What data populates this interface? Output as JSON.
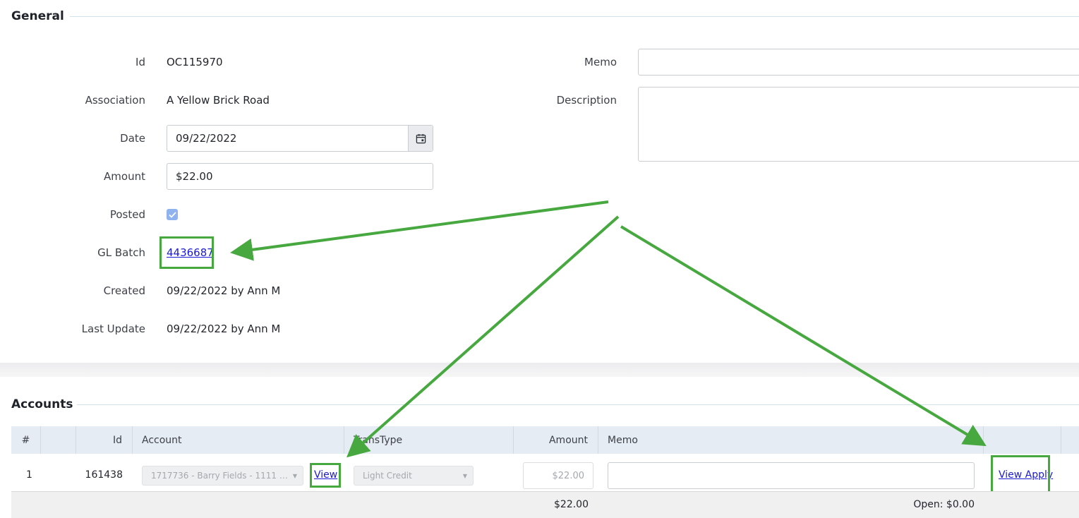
{
  "general": {
    "title": "General",
    "labels": {
      "id": "Id",
      "association": "Association",
      "date": "Date",
      "amount": "Amount",
      "posted": "Posted",
      "gl_batch": "GL Batch",
      "created": "Created",
      "last_update": "Last Update",
      "memo": "Memo",
      "description": "Description"
    },
    "values": {
      "id": "OC115970",
      "association": "A Yellow Brick Road",
      "date": "09/22/2022",
      "amount": "$22.00",
      "posted": true,
      "gl_batch": "4436687",
      "created": "09/22/2022 by Ann M",
      "last_update": "09/22/2022 by Ann M",
      "memo": "",
      "description": ""
    }
  },
  "accounts": {
    "title": "Accounts",
    "columns": [
      "#",
      "Id",
      "Account",
      "TransType",
      "Amount",
      "Memo"
    ],
    "rows": [
      {
        "num": "1",
        "id": "161438",
        "account": "1717736 - Barry Fields - 1111 Newto...",
        "view_label": "View",
        "trans_type": "Light Credit",
        "amount": "$22.00",
        "memo": "",
        "view_apply_label": "View Apply"
      }
    ],
    "footer": {
      "amount_total": "$22.00",
      "open": "Open: $0.00"
    }
  },
  "icons": {
    "calendar": "calendar-icon",
    "check": "check-icon",
    "caret": "caret-down-icon"
  },
  "colors": {
    "annotation_green": "#46a83f",
    "link_blue": "#1a1ad6",
    "table_header_bg": "#e6ecf3",
    "checkbox_blue": "#8fb3ee"
  }
}
